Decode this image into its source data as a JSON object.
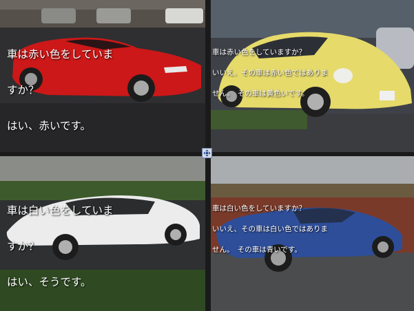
{
  "panels": [
    {
      "id": "red-car",
      "lines": [
        "車は赤い色をしていま",
        "すか？",
        "はい、赤いです。"
      ]
    },
    {
      "id": "yellow-car",
      "lines": [
        "車は赤い色をしていますか？",
        "いいえ、その車は赤い色ではありま",
        "せん。　その車は黄色いです。"
      ]
    },
    {
      "id": "white-car",
      "lines": [
        "車は白い色をしていま",
        "すか？",
        "はい、そうです。"
      ]
    },
    {
      "id": "blue-car",
      "lines": [
        "車は白い色をしていますか？",
        "いいえ、その車は白い色ではありま",
        "せん。　その車は青いです。"
      ]
    }
  ],
  "colors": {
    "red_car": "#cc1818",
    "yellow_car": "#e6da6a",
    "white_car": "#ececec",
    "blue_car": "#2e4e9a"
  },
  "icons": {
    "center": "expand-arrows-icon"
  }
}
